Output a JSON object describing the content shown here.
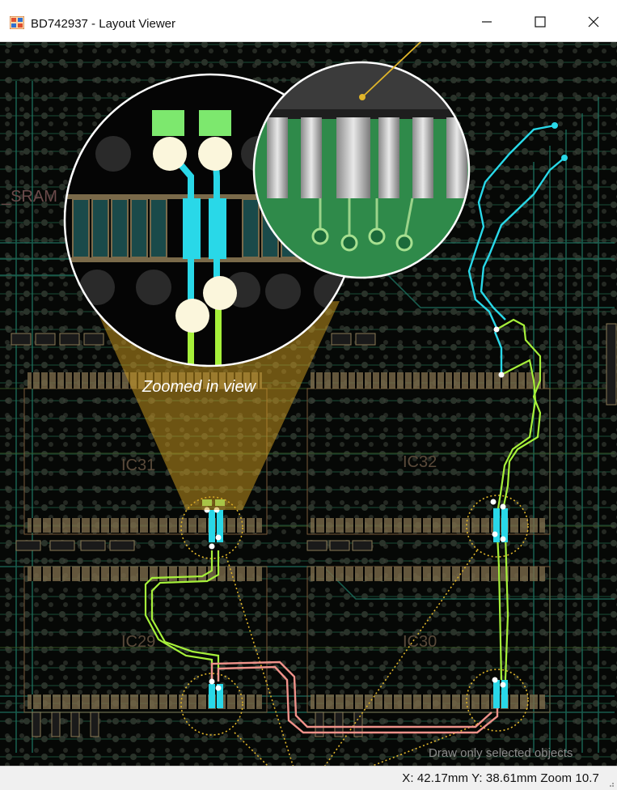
{
  "window": {
    "title": "BD742937 - Layout Viewer",
    "controls": {
      "minimize": "—",
      "maximize": "☐",
      "close": "✕"
    }
  },
  "canvas": {
    "zoom_caption": "Zoomed in view",
    "hint": "Draw only selected objects",
    "labels": {
      "sram": "_SRAM",
      "ic31": "IC31",
      "ic32": "IC32",
      "ic29": "IC29",
      "ic30": "IC30"
    }
  },
  "status": {
    "coords": "X: 42.17mm  Y: 38.61mm  Zoom 10.7"
  },
  "colors": {
    "cyan_trace": "#29d8e8",
    "green_trace": "#a6f03a",
    "pink_trace": "#f0928a",
    "highlight": "#e0b52a",
    "pad_green": "#7de86e"
  }
}
